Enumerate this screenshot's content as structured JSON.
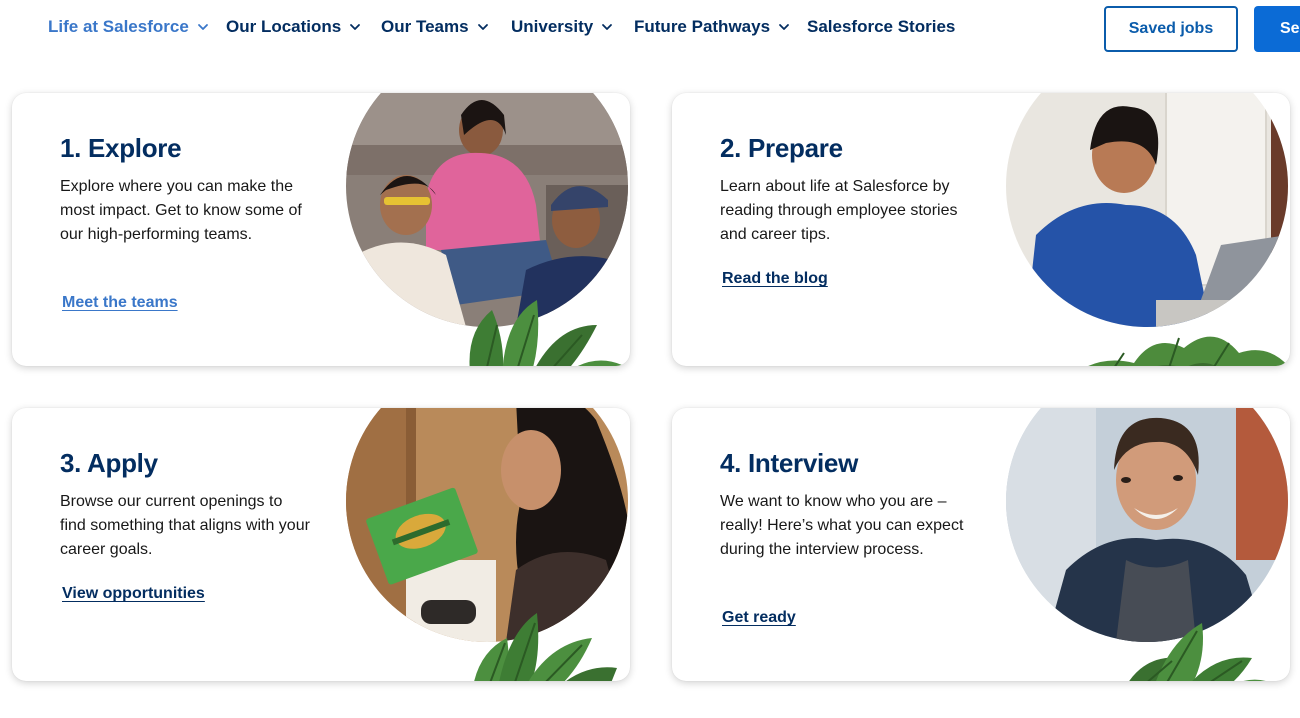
{
  "nav": {
    "items": [
      {
        "label": "Life at Salesforce",
        "active": true,
        "dropdown": true
      },
      {
        "label": "Our Locations",
        "active": false,
        "dropdown": true
      },
      {
        "label": "Our Teams",
        "active": false,
        "dropdown": true
      },
      {
        "label": "University",
        "active": false,
        "dropdown": true
      },
      {
        "label": "Future Pathways",
        "active": false,
        "dropdown": true
      },
      {
        "label": "Salesforce Stories",
        "active": false,
        "dropdown": false
      }
    ],
    "saved_jobs_label": "Saved jobs",
    "search_label": "Se"
  },
  "cards": [
    {
      "title": "1. Explore",
      "description": "Explore where you can make the most impact. Get to know some of our high-performing teams.",
      "link": "Meet the teams",
      "link_color": "#3a77c9"
    },
    {
      "title": "2. Prepare",
      "description": "Learn about life at Salesforce by reading through employee stories and career tips.",
      "link": "Read the blog",
      "link_color": "#032d60"
    },
    {
      "title": "3. Apply",
      "description": "Browse our current openings to find something that aligns with your career goals.",
      "link": "View opportunities",
      "link_color": "#032d60"
    },
    {
      "title": "4. Interview",
      "description": "We want to know who you are – really! Here’s what you can expect during the interview process.",
      "link": "Get ready",
      "link_color": "#032d60"
    }
  ],
  "colors": {
    "brand_navy": "#032d60",
    "accent_blue": "#0b5cab",
    "active_link": "#3a77c9",
    "plant_green": "#3e7d34"
  }
}
